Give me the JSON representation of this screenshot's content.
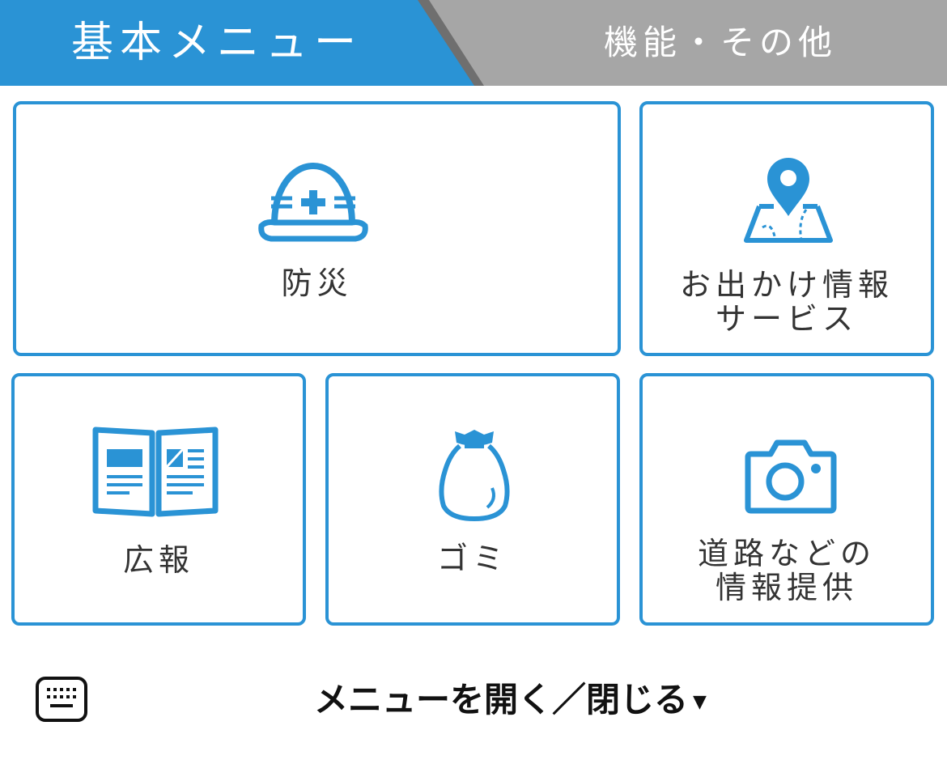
{
  "tabs": {
    "active_label": "基本メニュー",
    "inactive_label": "機能・その他"
  },
  "tiles": {
    "disaster": {
      "label": "防災",
      "icon": "helmet-icon"
    },
    "outing": {
      "label_line1": "お出かけ情報",
      "label_line2": "サービス",
      "icon": "map-pin-icon"
    },
    "publicity": {
      "label": "広報",
      "icon": "newspaper-icon"
    },
    "garbage": {
      "label": "ゴミ",
      "icon": "garbage-bag-icon"
    },
    "road": {
      "label_line1": "道路などの",
      "label_line2": "情報提供",
      "icon": "camera-icon"
    }
  },
  "bottom": {
    "toggle_label": "メニューを開く／閉じる",
    "caret": "▼",
    "keyboard_icon": "keyboard-icon"
  },
  "colors": {
    "accent": "#2a93d5",
    "tab_inactive": "#a6a6a6"
  }
}
